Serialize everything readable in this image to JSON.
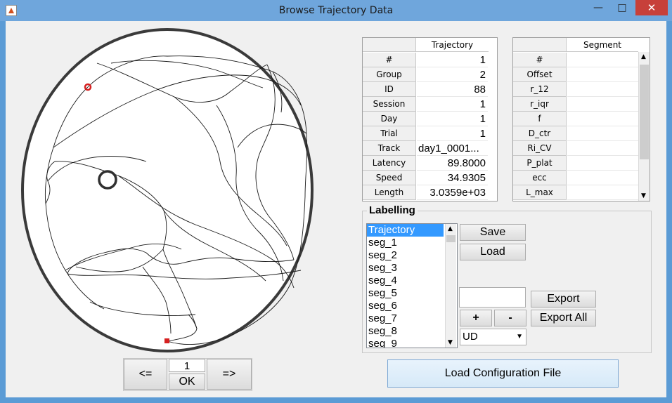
{
  "window": {
    "title": "Browse Trajectory Data",
    "minimize_glyph": "—",
    "maximize_glyph": "□",
    "close_glyph": "✕"
  },
  "plot": {
    "start_marker_color": "#d62020",
    "end_marker_color": "#d62020",
    "platform_color": "#303030",
    "arena_color": "#333333"
  },
  "navigation": {
    "prev_label": "<=",
    "next_label": "=>",
    "index_value": "1",
    "ok_label": "OK"
  },
  "trajectory_table": {
    "header": "Trajectory",
    "rows": [
      {
        "label": "#",
        "value": "1"
      },
      {
        "label": "Group",
        "value": "2"
      },
      {
        "label": "ID",
        "value": "88"
      },
      {
        "label": "Session",
        "value": "1"
      },
      {
        "label": "Day",
        "value": "1"
      },
      {
        "label": "Trial",
        "value": "1"
      },
      {
        "label": "Track",
        "value": "day1_0001..."
      },
      {
        "label": "Latency",
        "value": "89.8000"
      },
      {
        "label": "Speed",
        "value": "34.9305"
      },
      {
        "label": "Length",
        "value": "3.0359e+03"
      }
    ]
  },
  "segment_table": {
    "header": "Segment",
    "rows": [
      {
        "label": "#",
        "value": ""
      },
      {
        "label": "Offset",
        "value": ""
      },
      {
        "label": "r_12",
        "value": ""
      },
      {
        "label": "r_iqr",
        "value": ""
      },
      {
        "label": "f",
        "value": ""
      },
      {
        "label": "D_ctr",
        "value": ""
      },
      {
        "label": "Ri_CV",
        "value": ""
      },
      {
        "label": "P_plat",
        "value": ""
      },
      {
        "label": "ecc",
        "value": ""
      },
      {
        "label": "L_max",
        "value": ""
      }
    ]
  },
  "labelling": {
    "title": "Labelling",
    "items": [
      "Trajectory",
      "seg_1",
      "seg_2",
      "seg_3",
      "seg_4",
      "seg_5",
      "seg_6",
      "seg_7",
      "seg_8",
      "seg_9"
    ],
    "selected_index": 0,
    "save_label": "Save",
    "load_label": "Load",
    "export_label": "Export",
    "export_all_label": "Export All",
    "plus_label": "+",
    "minus_label": "-",
    "tag_select_value": "UD",
    "tag_input_value": ""
  },
  "load_config_label": "Load Configuration File"
}
